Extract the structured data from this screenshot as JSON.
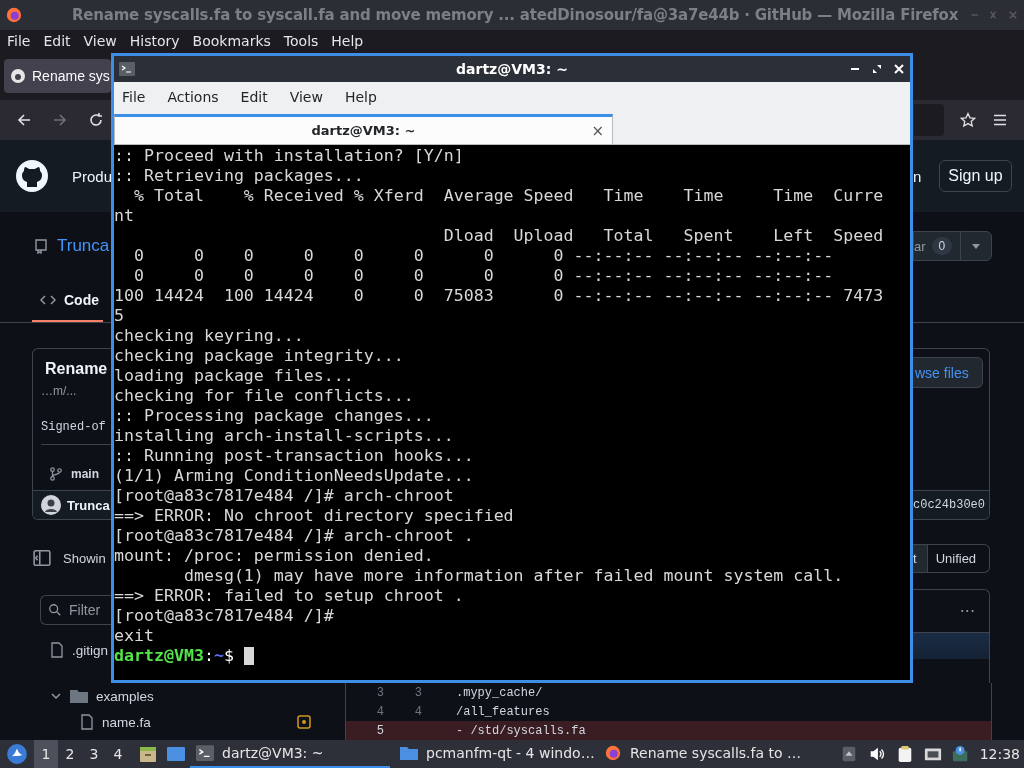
{
  "firefox": {
    "title": "Rename syscalls.fa to syscall.fa and move memory ... atedDinosour/fa@3a7e44b · GitHub — Mozilla Firefox",
    "menu": [
      "File",
      "Edit",
      "View",
      "History",
      "Bookmarks",
      "Tools",
      "Help"
    ],
    "tab": {
      "title": "Rename sys"
    },
    "header": {
      "nav_fragment": "Produ",
      "nav_fragment_right": "n",
      "sign_up": "Sign up"
    },
    "repo": {
      "name": "Trunca",
      "star_fragment": "ar",
      "star_count": "0"
    },
    "tabs": [
      {
        "label": "Code",
        "selected": true
      }
    ],
    "commit": {
      "title": "Rename",
      "body_fragment": "…m/...",
      "signoff_fragment": "Signed-of",
      "branch": "main",
      "author": "Trunca",
      "browse_fragment": "wse files",
      "sha_fragment": "c0c24b30e0"
    },
    "diff_toolbar": {
      "showing_fragment": "Showin",
      "view_modes": [
        {
          "label": "t",
          "selected": true
        },
        {
          "label": "Unified",
          "selected": false
        }
      ]
    },
    "file_filter": {
      "placeholder": "Filter"
    },
    "file_tree": [
      {
        "name": ".gitign",
        "kind": "file"
      },
      {
        "name": "examples",
        "kind": "folder",
        "expanded": true,
        "children": [
          {
            "name": "name.fa",
            "kind": "file",
            "modified": true
          }
        ]
      }
    ],
    "diff": {
      "menu": "···",
      "lines": [
        {
          "old": "3",
          "new": "3",
          "text": ".mypy_cache/",
          "kind": "context"
        },
        {
          "old": "4",
          "new": "4",
          "text": "/all_features",
          "kind": "context"
        },
        {
          "old": "5",
          "text": "- /std/syscalls.fa",
          "kind": "deleted"
        }
      ]
    }
  },
  "terminal": {
    "title": "dartz@VM3: ~",
    "menu": [
      "File",
      "Actions",
      "Edit",
      "View",
      "Help"
    ],
    "tabs": [
      {
        "title": "dartz@VM3: ~",
        "close": "×",
        "selected": true
      }
    ],
    "lines": [
      ":: Proceed with installation? [Y/n]",
      ":: Retrieving packages...",
      "  % Total    % Received % Xferd  Average Speed   Time    Time     Time  Curre",
      "nt",
      "                                 Dload  Upload   Total   Spent    Left  Speed",
      "  0     0    0     0    0     0      0      0 --:--:-- --:--:-- --:--:--",
      "  0     0    0     0    0     0      0      0 --:--:-- --:--:-- --:--:--",
      "100 14424  100 14424    0     0  75083      0 --:--:-- --:--:-- --:--:-- 7473",
      "5",
      "checking keyring...",
      "checking package integrity...",
      "loading package files...",
      "checking for file conflicts...",
      ":: Processing package changes...",
      "installing arch-install-scripts...",
      ":: Running post-transaction hooks...",
      "(1/1) Arming ConditionNeedsUpdate...",
      "[root@a83c7817e484 /]# arch-chroot",
      "==> ERROR: No chroot directory specified",
      "[root@a83c7817e484 /]# arch-chroot .",
      "mount: /proc: permission denied.",
      "       dmesg(1) may have more information after failed mount system call.",
      "==> ERROR: failed to setup chroot .",
      "[root@a83c7817e484 /]#",
      "exit"
    ],
    "prompt": {
      "user_host": "dartz@VM3",
      "separator": ":",
      "path": "~",
      "symbol": "$"
    }
  },
  "taskbar": {
    "desktops": [
      {
        "label": "1",
        "selected": true
      },
      {
        "label": "2",
        "selected": false
      },
      {
        "label": "3",
        "selected": false
      },
      {
        "label": "4",
        "selected": false
      }
    ],
    "tasks": [
      {
        "kind": "terminal",
        "title": "dartz@VM3: ~",
        "selected": true
      },
      {
        "kind": "folder",
        "title": "pcmanfm-qt - 4 windo…",
        "selected": false
      },
      {
        "kind": "browser",
        "title": "Rename syscalls.fa to …",
        "selected": false
      }
    ],
    "clock": "12:38"
  }
}
